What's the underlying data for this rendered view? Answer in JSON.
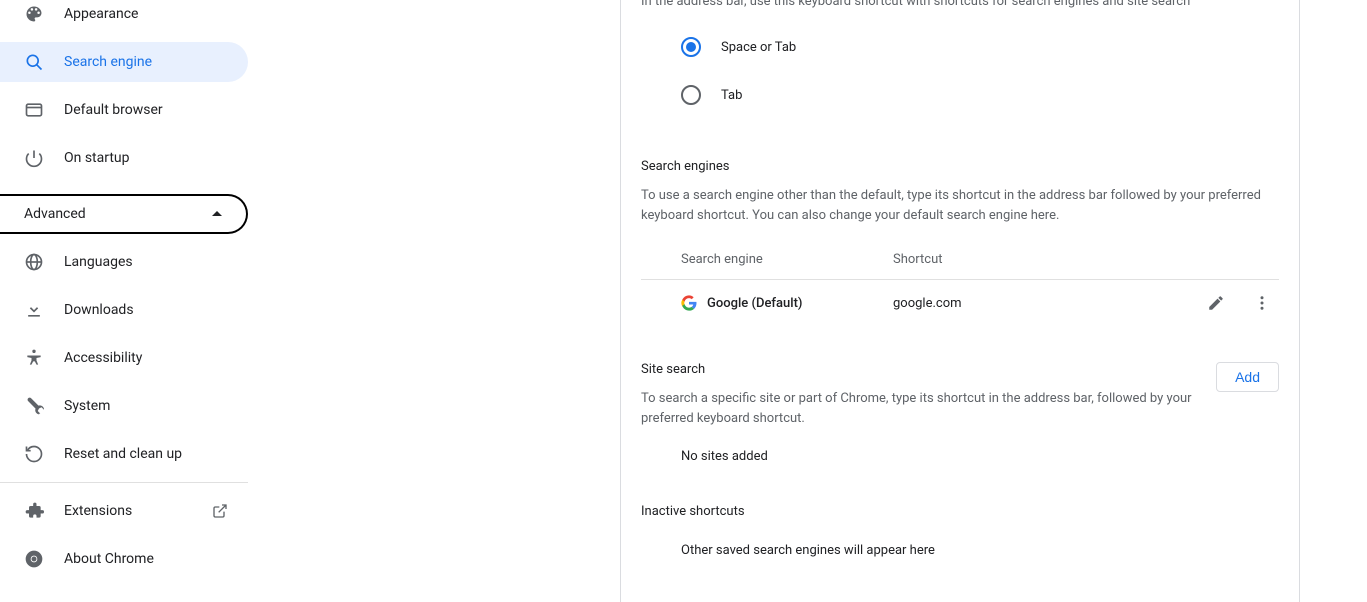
{
  "sidebar": {
    "items": [
      {
        "label": "Appearance"
      },
      {
        "label": "Search engine"
      },
      {
        "label": "Default browser"
      },
      {
        "label": "On startup"
      }
    ],
    "advanced_label": "Advanced",
    "advanced_items": [
      {
        "label": "Languages"
      },
      {
        "label": "Downloads"
      },
      {
        "label": "Accessibility"
      },
      {
        "label": "System"
      },
      {
        "label": "Reset and clean up"
      }
    ],
    "footer": [
      {
        "label": "Extensions"
      },
      {
        "label": "About Chrome"
      }
    ]
  },
  "main": {
    "top_partial": "In the address bar, use this keyboard shortcut with shortcuts for search engines and site search",
    "radio": {
      "option1": "Space or Tab",
      "option2": "Tab"
    },
    "search_engines": {
      "title": "Search engines",
      "desc": "To use a search engine other than the default, type its shortcut in the address bar followed by your preferred keyboard shortcut. You can also change your default search engine here.",
      "col_engine": "Search engine",
      "col_shortcut": "Shortcut",
      "row": {
        "name": "Google (Default)",
        "shortcut": "google.com"
      }
    },
    "site_search": {
      "title": "Site search",
      "desc": "To search a specific site or part of Chrome, type its shortcut in the address bar, followed by your preferred keyboard shortcut.",
      "add_label": "Add",
      "empty": "No sites added"
    },
    "inactive": {
      "title": "Inactive shortcuts",
      "empty": "Other saved search engines will appear here"
    }
  }
}
